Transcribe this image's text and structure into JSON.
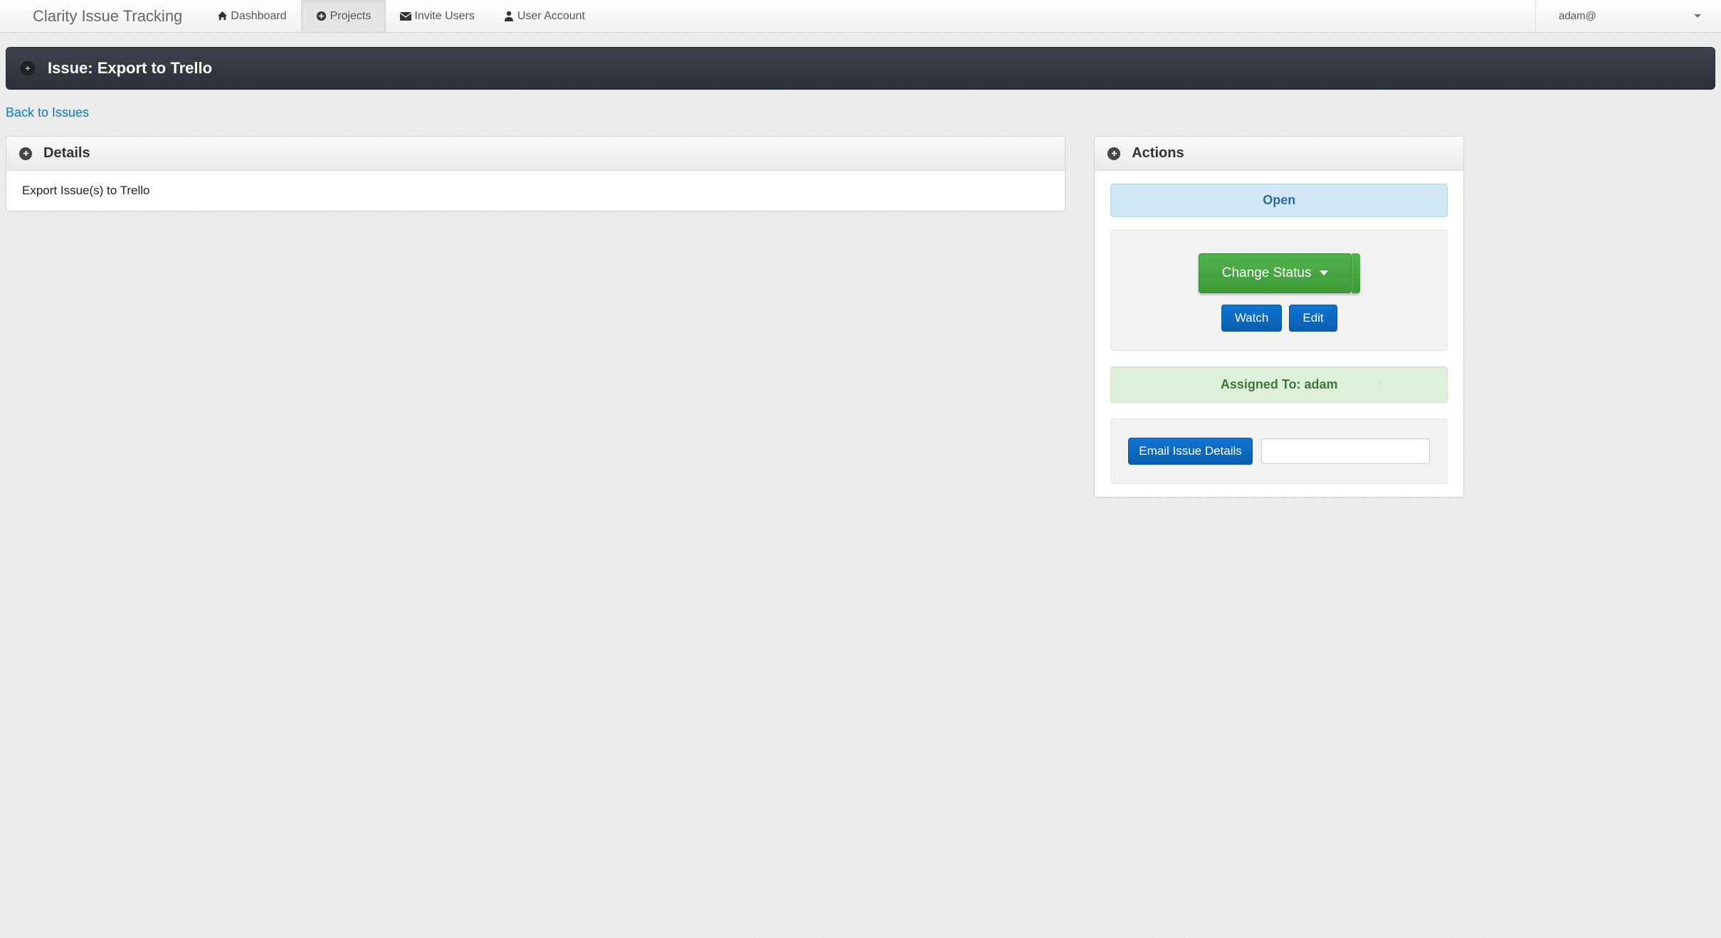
{
  "brand": "Clarity Issue Tracking",
  "nav": {
    "items": [
      {
        "label": "Dashboard",
        "icon": "home"
      },
      {
        "label": "Projects",
        "icon": "plus-circle",
        "active": true
      },
      {
        "label": "Invite Users",
        "icon": "mail"
      },
      {
        "label": "User Account",
        "icon": "user"
      }
    ]
  },
  "user_menu": {
    "label": "adam@"
  },
  "issue": {
    "title": "Issue: Export to Trello",
    "back_link": "Back to Issues"
  },
  "details": {
    "header": "Details",
    "description": "Export Issue(s) to Trello"
  },
  "actions": {
    "header": "Actions",
    "status": "Open",
    "change_status": "Change Status",
    "watch": "Watch",
    "edit": "Edit",
    "assigned_label": "Assigned To: adam",
    "email_button": "Email Issue Details",
    "email_placeholder": ""
  }
}
